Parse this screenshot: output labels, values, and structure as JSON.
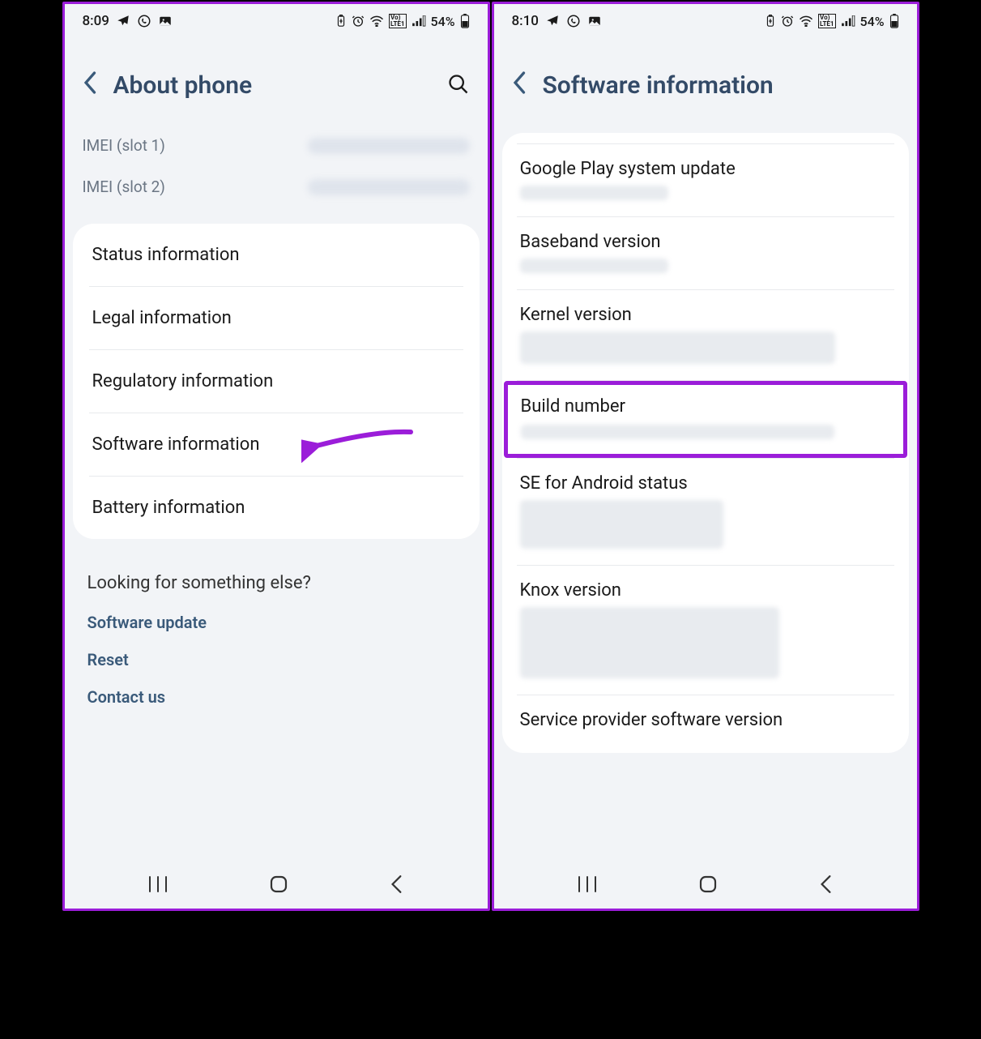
{
  "left": {
    "status": {
      "time": "8:09",
      "battery": "54%"
    },
    "header": {
      "title": "About phone"
    },
    "imei1_label": "IMEI (slot 1)",
    "imei2_label": "IMEI (slot 2)",
    "items": [
      "Status information",
      "Legal information",
      "Regulatory information",
      "Software information",
      "Battery information"
    ],
    "footer": {
      "heading": "Looking for something else?",
      "links": [
        "Software update",
        "Reset",
        "Contact us"
      ]
    }
  },
  "right": {
    "status": {
      "time": "8:10",
      "battery": "54%"
    },
    "header": {
      "title": "Software information"
    },
    "items": [
      "Google Play system update",
      "Baseband version",
      "Kernel version",
      "Build number",
      "SE for Android status",
      "Knox version",
      "Service provider software version"
    ]
  }
}
